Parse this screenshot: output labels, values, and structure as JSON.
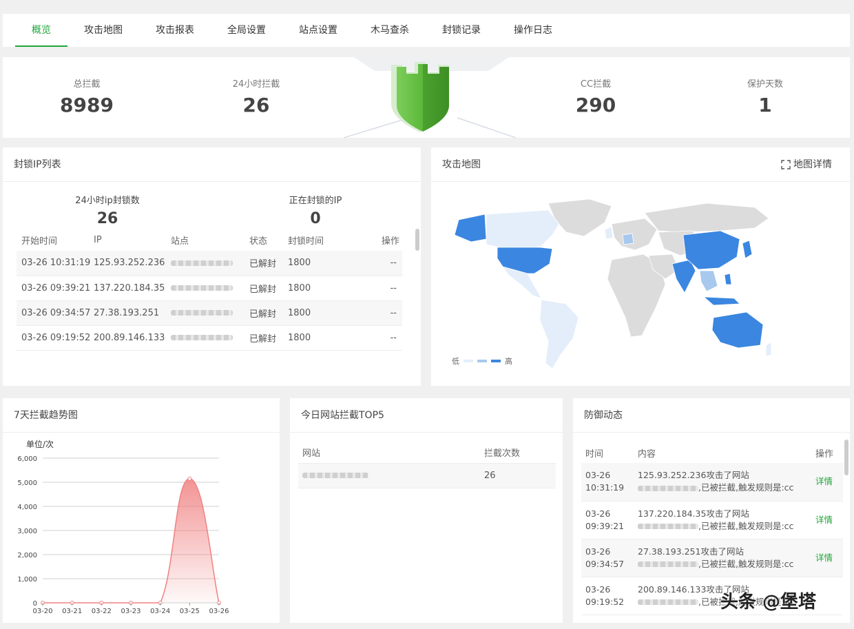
{
  "tabs": [
    {
      "label": "概览",
      "active": true
    },
    {
      "label": "攻击地图"
    },
    {
      "label": "攻击报表"
    },
    {
      "label": "全局设置"
    },
    {
      "label": "站点设置"
    },
    {
      "label": "木马查杀"
    },
    {
      "label": "封锁记录"
    },
    {
      "label": "操作日志"
    }
  ],
  "stats": {
    "total": {
      "label": "总拦截",
      "value": "8989"
    },
    "h24": {
      "label": "24小时拦截",
      "value": "26"
    },
    "cc": {
      "label": "CC拦截",
      "value": "290"
    },
    "days": {
      "label": "保护天数",
      "value": "1"
    }
  },
  "ip_panel": {
    "title": "封锁IP列表",
    "count24": {
      "label": "24小时ip封锁数",
      "value": "26"
    },
    "blocking": {
      "label": "正在封锁的IP",
      "value": "0"
    },
    "headers": [
      "开始时间",
      "IP",
      "站点",
      "状态",
      "封锁时间",
      "操作"
    ],
    "rows": [
      {
        "time": "03-26 10:31:19",
        "ip": "125.93.252.236",
        "status": "已解封",
        "duration": "1800",
        "op": "--"
      },
      {
        "time": "03-26 09:39:21",
        "ip": "137.220.184.35",
        "status": "已解封",
        "duration": "1800",
        "op": "--"
      },
      {
        "time": "03-26 09:34:57",
        "ip": "27.38.193.251",
        "status": "已解封",
        "duration": "1800",
        "op": "--"
      },
      {
        "time": "03-26 09:19:52",
        "ip": "200.89.146.133",
        "status": "已解封",
        "duration": "1800",
        "op": "--"
      }
    ]
  },
  "map_panel": {
    "title": "攻击地图",
    "detail": "地图详情",
    "legend_low": "低",
    "legend_high": "高",
    "colors": {
      "none": "#dcdcdc",
      "low": "#e4eefa",
      "mid": "#a8c8ee",
      "high": "#3b86e0"
    }
  },
  "trend_panel": {
    "title": "7天拦截趋势图",
    "unit": "单位/次"
  },
  "chart_data": {
    "type": "area",
    "x": [
      "03-20",
      "03-21",
      "03-22",
      "03-23",
      "03-24",
      "03-25",
      "03-26"
    ],
    "values": [
      0,
      0,
      0,
      0,
      0,
      5150,
      0
    ],
    "ylim": [
      0,
      6000
    ],
    "yticks": [
      "0",
      "1,000",
      "2,000",
      "3,000",
      "4,000",
      "5,000",
      "6,000"
    ],
    "ylabel": "单位/次",
    "grid": true,
    "color": "#f08080"
  },
  "top5_panel": {
    "title": "今日网站拦截TOP5",
    "headers": [
      "网站",
      "拦截次数"
    ],
    "rows": [
      {
        "count": "26"
      }
    ]
  },
  "defense_panel": {
    "title": "防御动态",
    "headers": [
      "时间",
      "内容",
      "操作"
    ],
    "rows": [
      {
        "date": "03-26",
        "time": "10:31:19",
        "line1": "125.93.252.236攻击了网站",
        "line2": ",已被拦截,触发规则是:cc",
        "op": "详情"
      },
      {
        "date": "03-26",
        "time": "09:39:21",
        "line1": "137.220.184.35攻击了网站",
        "line2": ",已被拦截,触发规则是:cc",
        "op": "详情"
      },
      {
        "date": "03-26",
        "time": "09:34:57",
        "line1": "27.38.193.251攻击了网站",
        "line2": ",已被拦截,触发规则是:cc",
        "op": "详情"
      },
      {
        "date": "03-26",
        "time": "09:19:52",
        "line1": "200.89.146.133攻击了网站",
        "line2": ",已被拦截,触发规则是:cc",
        "op": ""
      }
    ]
  },
  "watermark": "头条 @堡塔"
}
